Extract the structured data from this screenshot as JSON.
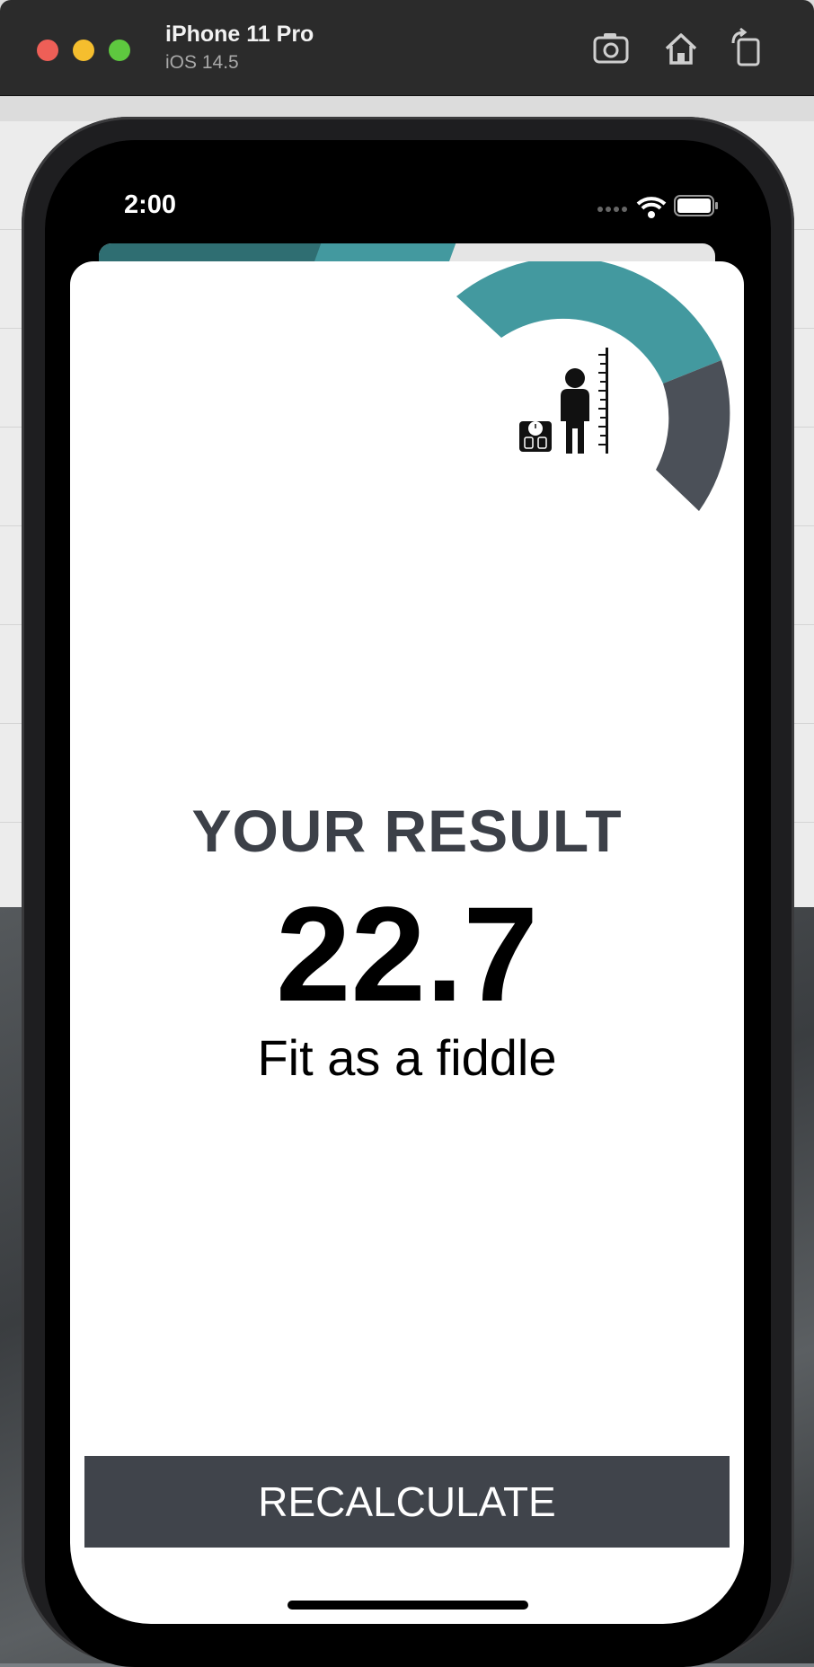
{
  "simulator": {
    "device_name": "iPhone 11 Pro",
    "os_version": "iOS 14.5",
    "icons": [
      "screenshot-icon",
      "home-icon",
      "rotate-icon"
    ]
  },
  "status_bar": {
    "time": "2:00",
    "icons": [
      "signal-icon",
      "wifi-icon",
      "battery-icon"
    ]
  },
  "result": {
    "title": "YOUR RESULT",
    "value": "22.7",
    "message": "Fit as a fiddle"
  },
  "actions": {
    "recalculate_label": "RECALCULATE"
  },
  "colors": {
    "teal": "#43999f",
    "dark_gray": "#40444b",
    "title_gray": "#3c4048"
  }
}
